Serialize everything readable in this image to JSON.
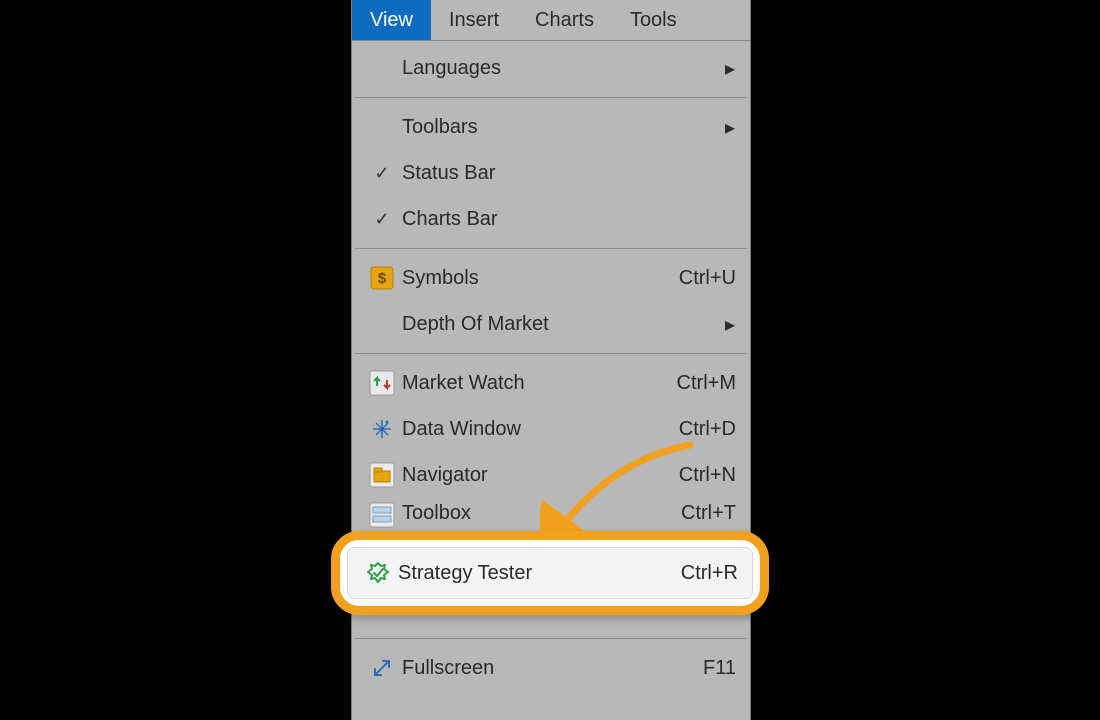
{
  "menubar": {
    "view": "View",
    "insert": "Insert",
    "charts": "Charts",
    "tools": "Tools"
  },
  "items": {
    "languages": "Languages",
    "toolbars": "Toolbars",
    "status_bar": "Status Bar",
    "charts_bar": "Charts Bar",
    "symbols": "Symbols",
    "symbols_accel": "Ctrl+U",
    "depth_of_market": "Depth Of Market",
    "market_watch": "Market Watch",
    "market_watch_accel": "Ctrl+M",
    "data_window": "Data Window",
    "data_window_accel": "Ctrl+D",
    "navigator": "Navigator",
    "navigator_accel": "Ctrl+N",
    "toolbox": "Toolbox",
    "toolbox_accel": "Ctrl+T",
    "strategy_tester": "Strategy Tester",
    "strategy_tester_accel": "Ctrl+R",
    "fullscreen": "Fullscreen",
    "fullscreen_accel": "F11"
  },
  "colors": {
    "accent": "#0f6bbf",
    "highlight": "#f1a11f"
  }
}
